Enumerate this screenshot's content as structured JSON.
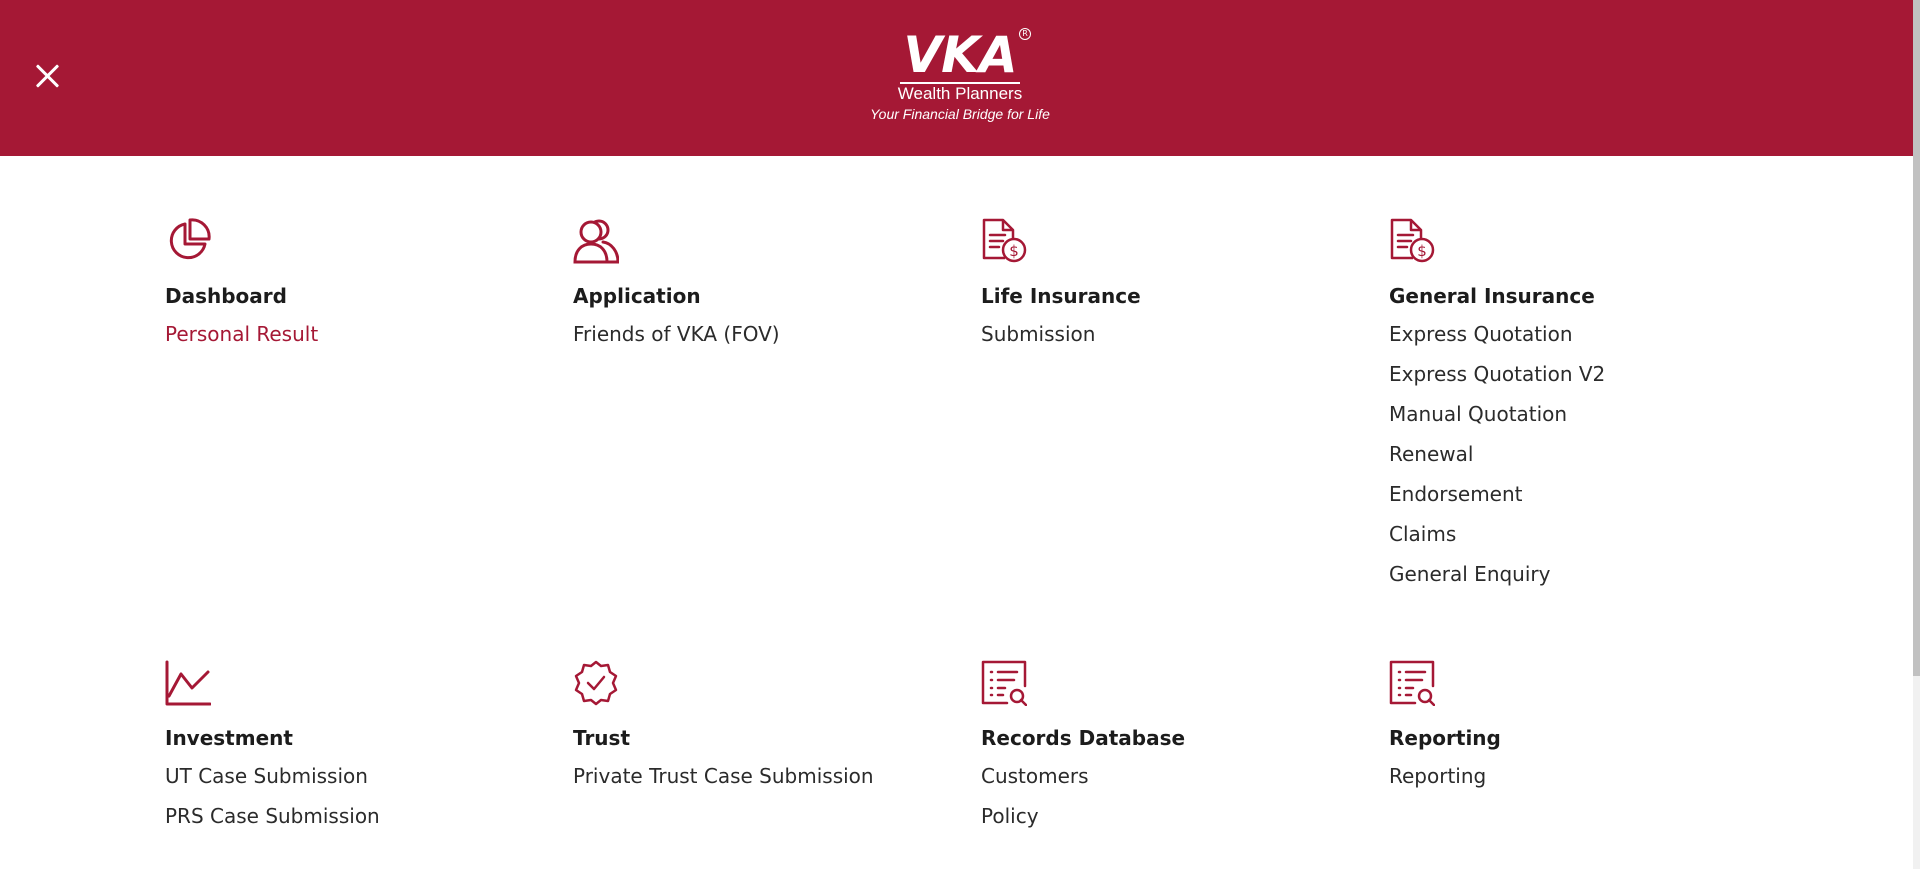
{
  "header": {
    "logo": {
      "brand": "VKA",
      "registered": "R",
      "subtitle": "Wealth Planners",
      "tagline": "Your Financial Bridge for Life"
    },
    "close_icon": "close-icon",
    "bg_color": "#a51835"
  },
  "accent_color": "#a51835",
  "sections": [
    {
      "icon": "pie-chart-icon",
      "title": "Dashboard",
      "items": [
        {
          "label": "Personal Result",
          "active": true
        }
      ]
    },
    {
      "icon": "users-icon",
      "title": "Application",
      "items": [
        {
          "label": "Friends of VKA (FOV)",
          "active": false
        }
      ]
    },
    {
      "icon": "document-dollar-icon",
      "title": "Life Insurance",
      "items": [
        {
          "label": "Submission",
          "active": false
        }
      ]
    },
    {
      "icon": "document-dollar-icon",
      "title": "General Insurance",
      "items": [
        {
          "label": "Express Quotation",
          "active": false
        },
        {
          "label": "Express Quotation V2",
          "active": false
        },
        {
          "label": "Manual Quotation",
          "active": false
        },
        {
          "label": "Renewal",
          "active": false
        },
        {
          "label": "Endorsement",
          "active": false
        },
        {
          "label": "Claims",
          "active": false
        },
        {
          "label": "General Enquiry",
          "active": false
        }
      ]
    },
    {
      "icon": "line-chart-icon",
      "title": "Investment",
      "items": [
        {
          "label": "UT Case Submission",
          "active": false
        },
        {
          "label": "PRS Case Submission",
          "active": false
        }
      ]
    },
    {
      "icon": "verified-badge-icon",
      "title": "Trust",
      "items": [
        {
          "label": "Private Trust Case Submission",
          "active": false
        }
      ]
    },
    {
      "icon": "list-search-icon",
      "title": "Records Database",
      "items": [
        {
          "label": "Customers",
          "active": false
        },
        {
          "label": "Policy",
          "active": false
        }
      ]
    },
    {
      "icon": "list-search-icon",
      "title": "Reporting",
      "items": [
        {
          "label": "Reporting",
          "active": false
        }
      ]
    }
  ]
}
